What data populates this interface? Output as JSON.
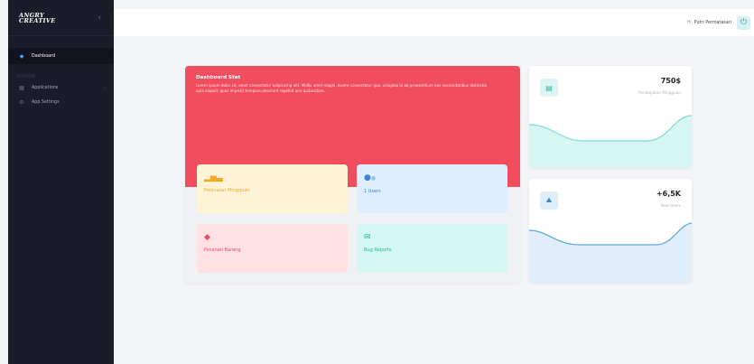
{
  "brand": {
    "line1": "ANGRY",
    "line2": "CREATIVE"
  },
  "sidebar": {
    "collapse_glyph": "‹",
    "active_item": {
      "label": "Dashboard",
      "icon": "diamond-icon"
    },
    "section_label": "CUSTOM",
    "items": [
      {
        "label": "Applications",
        "icon": "grid-icon",
        "chevron": "›"
      },
      {
        "label": "App Settings",
        "icon": "gear-icon"
      }
    ]
  },
  "topbar": {
    "greeting": "Hi,",
    "user_name": "Putri Permatasari",
    "power_icon": "power-icon"
  },
  "dashboard": {
    "title": "Dashboard Stat",
    "description": "Lorem ipsum dolor sit, amet consectetur adipisicing elit. Mollis amet magni, Iocere consectetur quo, voluptas id ab praesentium eos necessitatibus distinctio quia aliquid, quas impedit tempora deserunt repellat iure quibusdam.",
    "tiles": [
      {
        "label": "Penjualan Mingguan",
        "icon": "bar-chart-icon"
      },
      {
        "label": "1 Users",
        "icon": "users-icon"
      },
      {
        "label": "Pesanan Barang",
        "icon": "box-icon"
      },
      {
        "label": "Bug Reports",
        "icon": "mail-icon"
      }
    ]
  },
  "stats": [
    {
      "value": "750$",
      "label": "Pendapatan Mingguan",
      "icon": "wallet-icon",
      "wave_color": "#7fdcd3",
      "fill_color": "#d6f6f2"
    },
    {
      "value": "+6,5K",
      "label": "New Users",
      "icon": "users-icon",
      "wave_color": "#5aa9dc",
      "fill_color": "#e0eefb"
    }
  ]
}
